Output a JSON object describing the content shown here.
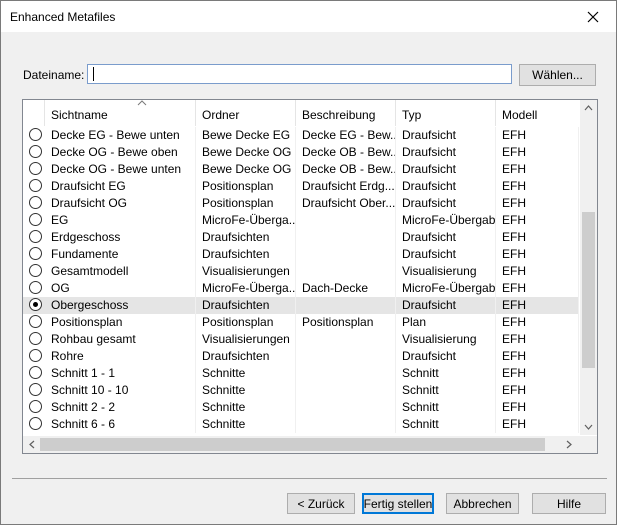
{
  "window": {
    "title": "Enhanced Metafiles"
  },
  "file": {
    "label": "Dateiname:",
    "value": "",
    "browse_label": "Wählen..."
  },
  "columns": [
    "Sichtname",
    "Ordner",
    "Beschreibung",
    "Typ",
    "Modell"
  ],
  "rows": [
    {
      "selected": false,
      "cells": [
        "Decke EG - Bewe unten",
        "Bewe Decke EG",
        "Decke EG - Bew...",
        "Draufsicht",
        "EFH"
      ]
    },
    {
      "selected": false,
      "cells": [
        "Decke OG - Bewe oben",
        "Bewe Decke OG",
        "Decke OB - Bew...",
        "Draufsicht",
        "EFH"
      ]
    },
    {
      "selected": false,
      "cells": [
        "Decke OG - Bewe unten",
        "Bewe Decke OG",
        "Decke OB - Bew...",
        "Draufsicht",
        "EFH"
      ]
    },
    {
      "selected": false,
      "cells": [
        "Draufsicht EG",
        "Positionsplan",
        "Draufsicht Erdg...",
        "Draufsicht",
        "EFH"
      ]
    },
    {
      "selected": false,
      "cells": [
        "Draufsicht OG",
        "Positionsplan",
        "Draufsicht Ober...",
        "Draufsicht",
        "EFH"
      ]
    },
    {
      "selected": false,
      "cells": [
        "EG",
        "MicroFe-Überga...",
        "",
        "MicroFe-Übergabe",
        "EFH"
      ]
    },
    {
      "selected": false,
      "cells": [
        "Erdgeschoss",
        "Draufsichten",
        "",
        "Draufsicht",
        "EFH"
      ]
    },
    {
      "selected": false,
      "cells": [
        "Fundamente",
        "Draufsichten",
        "",
        "Draufsicht",
        "EFH"
      ]
    },
    {
      "selected": false,
      "cells": [
        "Gesamtmodell",
        "Visualisierungen",
        "",
        "Visualisierung",
        "EFH"
      ]
    },
    {
      "selected": false,
      "cells": [
        "OG",
        "MicroFe-Überga...",
        "Dach-Decke",
        "MicroFe-Übergabe",
        "EFH"
      ]
    },
    {
      "selected": true,
      "cells": [
        "Obergeschoss",
        "Draufsichten",
        "",
        "Draufsicht",
        "EFH"
      ]
    },
    {
      "selected": false,
      "cells": [
        "Positionsplan",
        "Positionsplan",
        "Positionsplan",
        "Plan",
        "EFH"
      ]
    },
    {
      "selected": false,
      "cells": [
        "Rohbau gesamt",
        "Visualisierungen",
        "",
        "Visualisierung",
        "EFH"
      ]
    },
    {
      "selected": false,
      "cells": [
        "Rohre",
        "Draufsichten",
        "",
        "Draufsicht",
        "EFH"
      ]
    },
    {
      "selected": false,
      "cells": [
        "Schnitt 1 - 1",
        "Schnitte",
        "",
        "Schnitt",
        "EFH"
      ]
    },
    {
      "selected": false,
      "cells": [
        "Schnitt 10 - 10",
        "Schnitte",
        "",
        "Schnitt",
        "EFH"
      ]
    },
    {
      "selected": false,
      "cells": [
        "Schnitt 2 - 2",
        "Schnitte",
        "",
        "Schnitt",
        "EFH"
      ]
    },
    {
      "selected": false,
      "cells": [
        "Schnitt 6 - 6",
        "Schnitte",
        "",
        "Schnitt",
        "EFH"
      ]
    }
  ],
  "buttons": {
    "back": "< Zurück",
    "finish": "Fertig stellen",
    "cancel": "Abbrechen",
    "help": "Hilfe"
  }
}
